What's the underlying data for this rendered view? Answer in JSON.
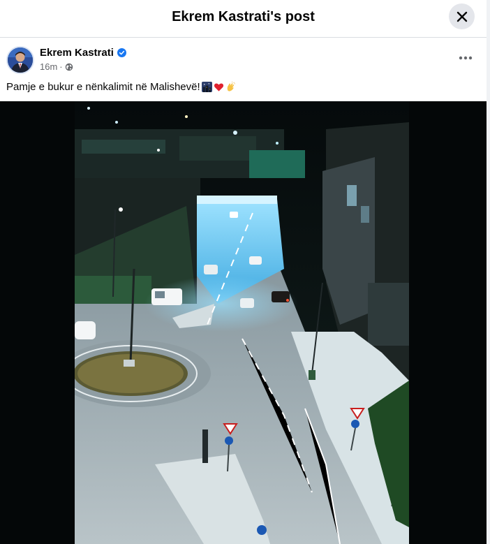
{
  "header": {
    "title": "Ekrem Kastrati's post"
  },
  "post": {
    "author": "Ekrem Kastrati",
    "time": "16m",
    "separator": "·",
    "caption": "Pamje e bukur e nënkalimit në Malishevë!",
    "caption_emojis": [
      "night-city-emoji",
      "red-heart-emoji",
      "clapping-hands-emoji"
    ]
  },
  "icons": {
    "close": "close-icon",
    "verified": "verified-badge-icon",
    "audience": "globe-icon",
    "more": "more-options-icon"
  },
  "colors": {
    "verified_blue": "#1877f2",
    "meta_gray": "#65676b",
    "close_bg": "#e4e6eb",
    "media_bg": "#040708"
  }
}
